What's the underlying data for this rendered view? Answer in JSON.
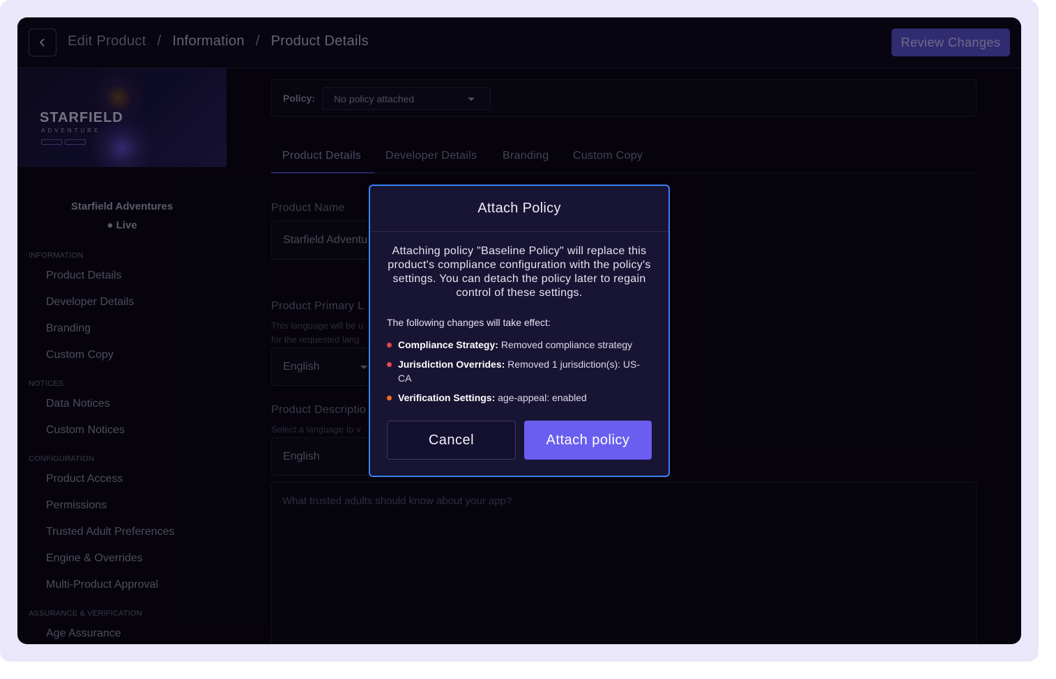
{
  "header": {
    "crumbs": [
      "Edit Product",
      "/",
      "Information",
      "/",
      "Product Details"
    ],
    "review_label": "Review Changes"
  },
  "sidebar": {
    "banner_logo": "STARFIELD",
    "banner_sub": "ADVENTURE",
    "product_name": "Starfield Adventures",
    "status": "● Live",
    "sections": [
      {
        "title": "INFORMATION",
        "items": [
          "Product Details",
          "Developer Details",
          "Branding",
          "Custom Copy"
        ]
      },
      {
        "title": "NOTICES",
        "items": [
          "Data Notices",
          "Custom Notices"
        ]
      },
      {
        "title": "CONFIGURATION",
        "items": [
          "Product Access",
          "Permissions",
          "Trusted Adult Preferences",
          "Engine & Overrides",
          "Multi-Product Approval"
        ]
      },
      {
        "title": "ASSURANCE & VERIFICATION",
        "items": [
          "Age Assurance"
        ]
      }
    ]
  },
  "policy": {
    "label": "Policy:",
    "selected": "No policy attached"
  },
  "tabs": [
    "Product Details",
    "Developer Details",
    "Branding",
    "Custom Copy"
  ],
  "form": {
    "name_label": "Product Name",
    "name_value": "Starfield Adventu",
    "lang_label": "Product Primary L",
    "lang_hint_1": "This language will be u",
    "lang_hint_2": "for the requested lang",
    "lang_value": "English",
    "desc_label": "Product Descriptio",
    "desc_hint": "Select a language to v",
    "desc_lang_value": "English",
    "desc_placeholder": "What trusted adults should know about your app?"
  },
  "modal": {
    "title": "Attach Policy",
    "message": "Attaching policy \"Baseline Policy\" will replace this product's compliance configuration with the policy's settings. You can detach the policy later to regain control of these settings.",
    "changes_intro": "The following changes will take effect:",
    "changes": [
      {
        "label": "Compliance Strategy:",
        "text": " Removed compliance strategy",
        "color": "#e5484d"
      },
      {
        "label": "Jurisdiction Overrides:",
        "text": " Removed 1 jurisdiction(s): US-CA",
        "color": "#e5484d"
      },
      {
        "label": "Verification Settings:",
        "text": " age-appeal: enabled",
        "color": "#f76b15"
      }
    ],
    "cancel_label": "Cancel",
    "attach_label": "Attach policy"
  },
  "colors": {
    "accent": "#6a5ef0",
    "modal_border": "#3b82f6",
    "removed": "#e5484d",
    "changed": "#f76b15"
  }
}
